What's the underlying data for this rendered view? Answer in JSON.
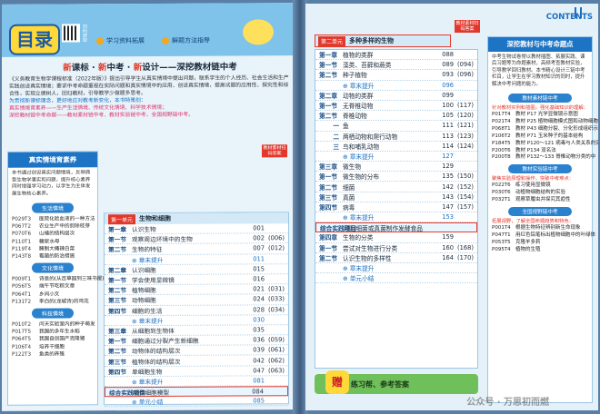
{
  "header": {
    "logo": "目录",
    "qr_label": "扫码获取",
    "links": [
      "学习资料拓展",
      "解题方法指导"
    ]
  },
  "intro": {
    "title_parts": [
      "新",
      "课标 · ",
      "新",
      "中考 · ",
      "新",
      "设计——深挖教材链中考"
    ],
    "para1": "《义务教育生物学课程标准（2022年版）》提出引导学生从真实情境中提出问题，联系学生的个人经历、社会生活和生产实践创设真实情境；要求中考命题重视在实际问题和真实情境中的应用、创设真实情境，提高试题的应用性、探究性和综合性，实现立德树人，回归教材，引导教学少做题多思考。",
    "para2": "为贯彻新课标理念，更好地应对教考新变化，本书特策划：",
    "line_a": "真实情境育素养——生产生活情境、传统文化情境、科学技术情境；",
    "line_b": "深挖教材链中考命题——教材素材链中考、教材实验链中考、全国视野链中考。"
  },
  "left_col": {
    "head": "真实情境育素养",
    "desc": "本书通过创设真实问题情境，反映典型生物学事实和问题，提升核心素养同时增强学习动力，以学生为主体发展生物核心素养。",
    "groups": [
      {
        "pill": "生活情境",
        "items": [
          [
            "P029T3",
            "医院化验血液的一种方法"
          ],
          [
            "P067T2",
            "农业生产中的剪除枝芽"
          ],
          [
            "P070T6",
            "山楂的结构层次"
          ],
          [
            "P110T1",
            "糖尿水母"
          ],
          [
            "P119T4",
            "腌制大桶辣白菜"
          ],
          [
            "P143T8",
            "霉菌的防治措施"
          ]
        ]
      },
      {
        "pill": "文化情境",
        "items": [
          [
            "P009T1",
            "诗意的(从百草园到三味书屋)"
          ],
          [
            "P056T5",
            "端午节吃粽文章"
          ],
          [
            "P064T1",
            "乡间小文"
          ],
          [
            "P131T2",
            "李白的(龙城诗)的鸡花"
          ]
        ]
      },
      {
        "pill": "科技情境",
        "items": [
          [
            "P010T2",
            "闫天实验室内的种子萌发"
          ],
          [
            "P017T5",
            "我国的多年生水稻"
          ],
          [
            "P064T5",
            "我国自创国产克隆猪"
          ],
          [
            "P106T4",
            "培养干细胞"
          ],
          [
            "P122T3",
            "鱼类的养殖"
          ]
        ]
      }
    ]
  },
  "unit1": {
    "tag": "第一单元",
    "title": "生物和细胞",
    "corner": "教材素材扫码答案",
    "rows": [
      {
        "ch": "第一章",
        "t": "认识生物",
        "p": "001",
        "p2": ""
      },
      {
        "ch": "第一节",
        "t": "观察周边环境中的生物",
        "p": "002",
        "p2": "(006)"
      },
      {
        "ch": "第二节",
        "t": "生物的特征",
        "p": "007",
        "p2": "(012)"
      },
      {
        "ch": "",
        "t": "章末提升",
        "p": "011",
        "p2": "",
        "ex": true
      },
      {
        "ch": "第二章",
        "t": "认识细胞",
        "p": "015",
        "p2": ""
      },
      {
        "ch": "第一节",
        "t": "学会使用显微镜",
        "p": "016",
        "p2": ""
      },
      {
        "ch": "第二节",
        "t": "植物细胞",
        "p": "021",
        "p2": "(031)"
      },
      {
        "ch": "第三节",
        "t": "动物细胞",
        "p": "024",
        "p2": "(033)"
      },
      {
        "ch": "第四节",
        "t": "细胞的生活",
        "p": "028",
        "p2": "(034)"
      },
      {
        "ch": "",
        "t": "章末提升",
        "p": "030",
        "p2": "",
        "ex": true
      },
      {
        "ch": "第三章",
        "t": "从细胞到生物体",
        "p": "035",
        "p2": ""
      },
      {
        "ch": "第一节",
        "t": "细胞通过分裂产生新细胞",
        "p": "036",
        "p2": "(059)"
      },
      {
        "ch": "第二节",
        "t": "动物体的结构层次",
        "p": "039",
        "p2": "(061)"
      },
      {
        "ch": "第三节",
        "t": "植物体的结构层次",
        "p": "042",
        "p2": "(062)"
      },
      {
        "ch": "第四节",
        "t": "单细胞生物",
        "p": "047",
        "p2": "(063)"
      },
      {
        "ch": "",
        "t": "章末提升",
        "p": "081",
        "p2": "",
        "ex": true
      },
      {
        "ch": "综合实践项目",
        "t": "制作细胞模型",
        "p": "084",
        "p2": "",
        "practice": true
      },
      {
        "ch": "",
        "t": "单元小结",
        "p": "085",
        "p2": "",
        "ex": true
      }
    ]
  },
  "unit2": {
    "tag": "第二单元",
    "title": "多种多样的生物",
    "corner": "教材素材扫码答案",
    "rows": [
      {
        "ch": "第一章",
        "t": "植物的类群",
        "p": "088",
        "p2": ""
      },
      {
        "ch": "第一节",
        "t": "藻类、苔藓和蕨类",
        "p": "089",
        "p2": "(094)"
      },
      {
        "ch": "第二节",
        "t": "种子植物",
        "p": "093",
        "p2": "(096)"
      },
      {
        "ch": "",
        "t": "章末提升",
        "p": "096",
        "p2": "",
        "ex": true
      },
      {
        "ch": "第二章",
        "t": "动物的类群",
        "p": "099",
        "p2": ""
      },
      {
        "ch": "第一节",
        "t": "无脊椎动物",
        "p": "100",
        "p2": "(117)"
      },
      {
        "ch": "第二节",
        "t": "脊椎动物",
        "p": "105",
        "p2": "(120)"
      },
      {
        "ch": "一",
        "t": "鱼",
        "p": "111",
        "p2": "(121)",
        "sub": true
      },
      {
        "ch": "二",
        "t": "两栖动物和爬行动物",
        "p": "113",
        "p2": "(123)",
        "sub": true
      },
      {
        "ch": "三",
        "t": "鸟和哺乳动物",
        "p": "114",
        "p2": "(124)",
        "sub": true
      },
      {
        "ch": "",
        "t": "章末提升",
        "p": "127",
        "p2": "",
        "ex": true
      },
      {
        "ch": "第三章",
        "t": "微生物",
        "p": "129",
        "p2": ""
      },
      {
        "ch": "第一节",
        "t": "微生物的分布",
        "p": "135",
        "p2": "(150)"
      },
      {
        "ch": "第二节",
        "t": "细菌",
        "p": "142",
        "p2": "(152)"
      },
      {
        "ch": "第三节",
        "t": "真菌",
        "p": "143",
        "p2": "(154)"
      },
      {
        "ch": "第四节",
        "t": "病毒",
        "p": "147",
        "p2": "(157)"
      },
      {
        "ch": "",
        "t": "章末提升",
        "p": "153",
        "p2": "",
        "ex": true
      },
      {
        "ch": "综合实践项目",
        "t": "利用细菌或真菌制作发酵食品",
        "p": "",
        "p2": "",
        "practice": true
      },
      {
        "ch": "第四章",
        "t": "生物的分类",
        "p": "159",
        "p2": ""
      },
      {
        "ch": "第一节",
        "t": "尝试对生物进行分类",
        "p": "160",
        "p2": "(168)"
      },
      {
        "ch": "第二节",
        "t": "认识生物的多样性",
        "p": "164",
        "p2": "(170)"
      },
      {
        "ch": "",
        "t": "章末提升",
        "p": "",
        "p2": "",
        "ex": true
      },
      {
        "ch": "",
        "t": "单元小结",
        "p": "",
        "p2": "",
        "ex": true
      }
    ]
  },
  "right_col": {
    "contents_label": "CONTENTS",
    "head": "深挖教材与中考命题点",
    "desc": "中考生物试卷常以教材插图、拓展实践、课后习题等为命题素材，高频考查教材实验，引导教学回归教材。本书精心设计三链中考栏目，让学生在学习教材知识的同时，提升解决中考问题的能力。",
    "groups": [
      {
        "sub": "教材素材链中考",
        "note": "针对教材实例和插图，强化基础知识的理解：",
        "items": [
          [
            "P017T4",
            "教材 P17 光学显微镜示意图"
          ],
          [
            "P021T4",
            "教材 P25 植物细胞模式图和动物细胞模式图"
          ],
          [
            "P068T1",
            "教材 P43 细胞分裂、分化形成组织示意图"
          ],
          [
            "P106T2",
            "教材 P71 玉米种子的基本结构"
          ],
          [
            "P184T5",
            "教材 P120～121 病毒与人类关系的实例"
          ],
          [
            "P200T6",
            "教材 P134 双名法"
          ],
          [
            "P200T8",
            "教材 P132～133 脊椎动物分类的中"
          ]
        ]
      },
      {
        "sub": "教材实验链中考",
        "note": "聚焦实验原理和操作，突破中考难点：",
        "items": [
          [
            "P022T6",
            "练习使用显微镜"
          ],
          [
            "P030T6",
            "动植物细胞结构的实验"
          ],
          [
            "P032T1",
            "观察草履虫并探究其趋性"
          ]
        ]
      },
      {
        "sub": "全国视野链中考",
        "note": "拓展视野，了解全国命题趋势和特色：",
        "items": [
          [
            "P001T4",
            "根据生物特征辨别新生命现象"
          ],
          [
            "P047T1",
            "用红色铅笔标出植物细胞中的叶绿体"
          ],
          [
            "P053T5",
            "克隆羊多莉"
          ],
          [
            "P095T4",
            "植物的生殖"
          ]
        ]
      }
    ]
  },
  "bottom": {
    "zeng": "赠",
    "practice": "练习帮、参考答案",
    "watermark": "公众号 · 万思初而燃"
  },
  "colors": {
    "accent": "#1e74c4",
    "highlight": "#e23a2a",
    "page_bg": "#e8f3fa"
  }
}
